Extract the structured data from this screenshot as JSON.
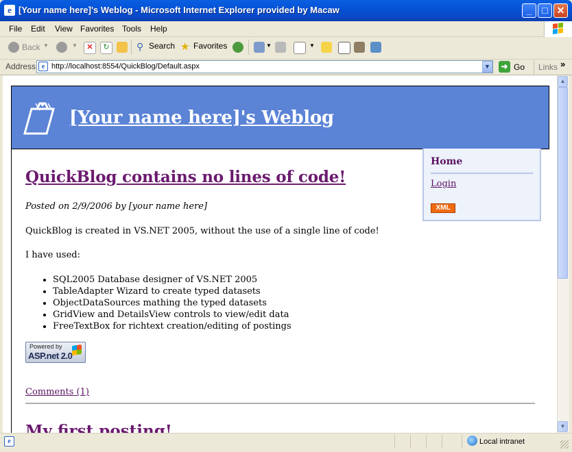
{
  "window": {
    "title": "[Your name here]'s Weblog - Microsoft Internet Explorer provided by Macaw",
    "app_icon": "e",
    "buttons": {
      "minimize": "_",
      "maximize": "□",
      "close": "✕"
    }
  },
  "menubar": {
    "file": "File",
    "edit": "Edit",
    "view": "View",
    "favorites": "Favorites",
    "tools": "Tools",
    "help": "Help"
  },
  "toolbar": {
    "back": "Back",
    "search": "Search",
    "favorites": "Favorites"
  },
  "address": {
    "label": "Address",
    "url": "http://localhost:8554/QuickBlog/Default.aspx",
    "go": "Go",
    "links": "Links",
    "chevron": "»"
  },
  "page": {
    "site_title": "[Your name here]'s Weblog",
    "sidebar": {
      "home": "Home",
      "login": "Login",
      "xml_badge": "XML"
    },
    "posts": [
      {
        "title": "QuickBlog contains no lines of code!",
        "meta": "Posted on 2/9/2006 by [your name here]",
        "intro": "QuickBlog is created in VS.NET 2005, without the use of a single line of code!",
        "used_label": "I have used:",
        "items": [
          "SQL2005 Database designer of VS.NET 2005",
          "TableAdapter Wizard to create typed datasets",
          "ObjectDataSources mathing the typed datasets",
          "GridView and DetailsView controls to view/edit data",
          "FreeTextBox for richtext creation/editing of postings"
        ],
        "badge_top": "Powered by",
        "badge_bottom": "ASP.net 2.0",
        "comments": "Comments (1)"
      },
      {
        "title": "My first posting!"
      }
    ]
  },
  "statusbar": {
    "zone": "Local intranet"
  },
  "colors": {
    "header_bg": "#5b83d6",
    "link_visited": "#6b1a6f",
    "sidebar_bg": "#edf2fb",
    "titlebar": "#0553d8"
  }
}
